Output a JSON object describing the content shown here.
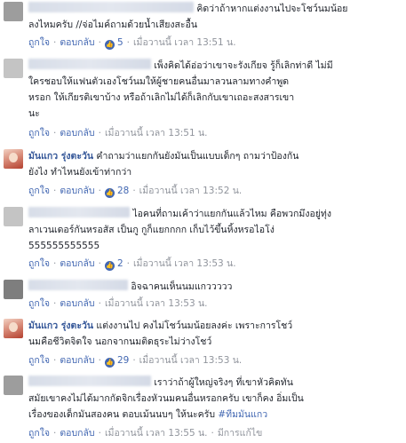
{
  "actions": {
    "like": "ถูกใจ",
    "reply": "ตอบกลับ",
    "edited": "มีการแก้ไข"
  },
  "comments": [
    {
      "name": "",
      "line1": "คิดว่าถ้าหากแต่งงานไปจะโชว์นมน้อย",
      "line2": "ลงไหมครับ //จ่อไมค์ถามด้วยน้ำเสียงสะอื้น",
      "likes": "5",
      "time": "เมื่อวานนี้ เวลา 13:51 น."
    },
    {
      "name": "",
      "line1": "เพ็งคิดได้อ่อว่าเขาจะรังเกียจ รู้ก็เลิกท่าดี ไม่มี",
      "line2": "ใครชอบให้แฟนตัวเองโชว์นมให้ผู้ชายคนอื่นมาลวนลามทางคำพูด",
      "line3": "หรอก ให้เกียรติเขาบ้าง หรือถ้าเลิกไม่ได้ก็เลิกกับเขาเถอะสงสารเขา",
      "line4": "นะ",
      "likes": "",
      "time": "เมื่อวานนี้ เวลา 13:51 น."
    },
    {
      "name": "มันแกว รุ่งตะวัน",
      "line1": "คำถามว่าแยกกันยังมันเป็นแบบเด็กๆ ถามว่าป้องกัน",
      "line2": "ยังไง ทำไหนยังเข้าท่ากว่า",
      "likes": "28",
      "time": "เมื่อวานนี้ เวลา 13:52 น."
    },
    {
      "name": "",
      "line1": "ไอคนที่ถามเค้าว่าแยกกันแล้วไหม คือพวกมึงอยู่ทุ่ง",
      "line2": "ลาเวนเดอร์กันหรอสัส เป็นกู กูก็แยกกกก เก็บไว้ขึ้นหิ้งหรอไอโง่",
      "line3": "555555555555",
      "likes": "2",
      "time": "เมื่อวานนี้ เวลา 13:53 น."
    },
    {
      "name": "",
      "line1": "อิจฉาคนเห็นนมแกววววว",
      "likes": "",
      "time": "เมื่อวานนี้ เวลา 13:53 น."
    },
    {
      "name": "มันแกว รุ่งตะวัน",
      "line1": "แต่งงานไป คงไม่โชว์นมน้อยลงค่ะ เพราะการโชว์",
      "line2": "นมคือชีวิตจิตใจ นอกจากนมติดธุระไม่ว่างโชว์",
      "likes": "29",
      "time": "เมื่อวานนี้ เวลา 13:53 น."
    },
    {
      "name": "",
      "line1": "เราว่าถ้าผู้ใหญ่จริงๆ ที่เขาหัวคิดทัน",
      "line2": "สมัยเขาคงไม่ได้มากกัดจิกเรื่องหัวนมคนอื่นหรอกครับ เขาก็คง อิ่มเป็น",
      "line3": "เรื่องของเด็กมันสองคน ตอบเม้นนบๆ ให้นะครับ",
      "hashtag": "#ทีมมันแกว",
      "likes": "",
      "time": "เมื่อวานนี้ เวลา 13:55 น."
    }
  ]
}
